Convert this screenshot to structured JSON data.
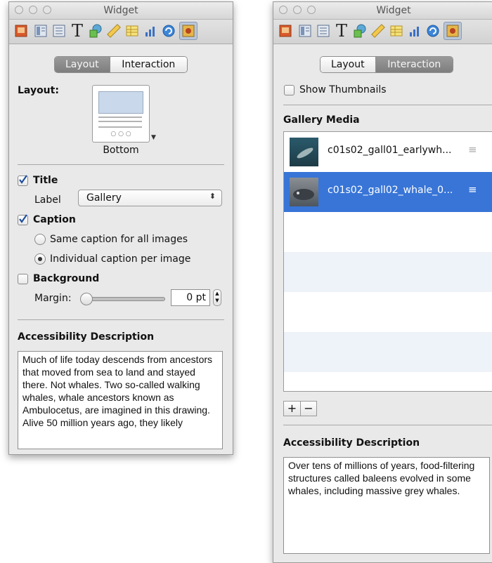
{
  "window_title": "Widget",
  "left": {
    "tabs": [
      "Layout",
      "Interaction"
    ],
    "layout_label": "Layout:",
    "layout_option": "Bottom",
    "title_label": "Title",
    "label_label": "Label",
    "label_value": "Gallery",
    "caption_label": "Caption",
    "radio_same": "Same caption for all images",
    "radio_individual": "Individual caption per image",
    "background_label": "Background",
    "margin_label": "Margin:",
    "margin_value": "0 pt",
    "access_header": "Accessibility Description",
    "access_text": "Much of life today descends from ancestors that moved from sea to land and stayed there. Not whales. Two so-called walking whales, whale ancestors known as Ambulocetus, are imagined in this drawing. Alive 50 million years ago, they likely"
  },
  "right": {
    "tabs": [
      "Layout",
      "Interaction"
    ],
    "show_thumbnails": "Show Thumbnails",
    "gallery_header": "Gallery Media",
    "items": [
      {
        "name": "c01s02_gall01_earlywh..."
      },
      {
        "name": "c01s02_gall02_whale_0..."
      }
    ],
    "add": "+",
    "remove": "−",
    "access_header": "Accessibility Description",
    "access_text": "Over tens of  millions of years, food-filtering structures called baleens evolved in some whales, including massive grey whales."
  },
  "colors": {
    "selection": "#3875d7",
    "check": "#1f4f9e"
  }
}
